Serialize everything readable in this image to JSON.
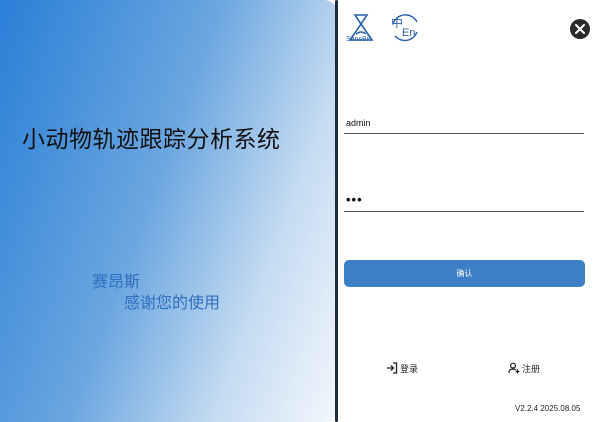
{
  "left": {
    "title": "小动物轨迹跟踪分析系统",
    "brand": "赛昂斯",
    "thanks": "感谢您的使用"
  },
  "header": {
    "logo_text": "SansBio",
    "lang_cn": "中",
    "lang_en": "En",
    "close_icon": "close-icon"
  },
  "form": {
    "username_value": "admin",
    "password_value": "•••",
    "confirm_label": "确认"
  },
  "footer": {
    "login_label": "登录",
    "register_label": "注册",
    "version": "V2.2.4 2025.08.05"
  },
  "colors": {
    "accent": "#3d7fc4",
    "brand_text": "#2f6fbf",
    "gradient_start": "#2a7fd6"
  }
}
